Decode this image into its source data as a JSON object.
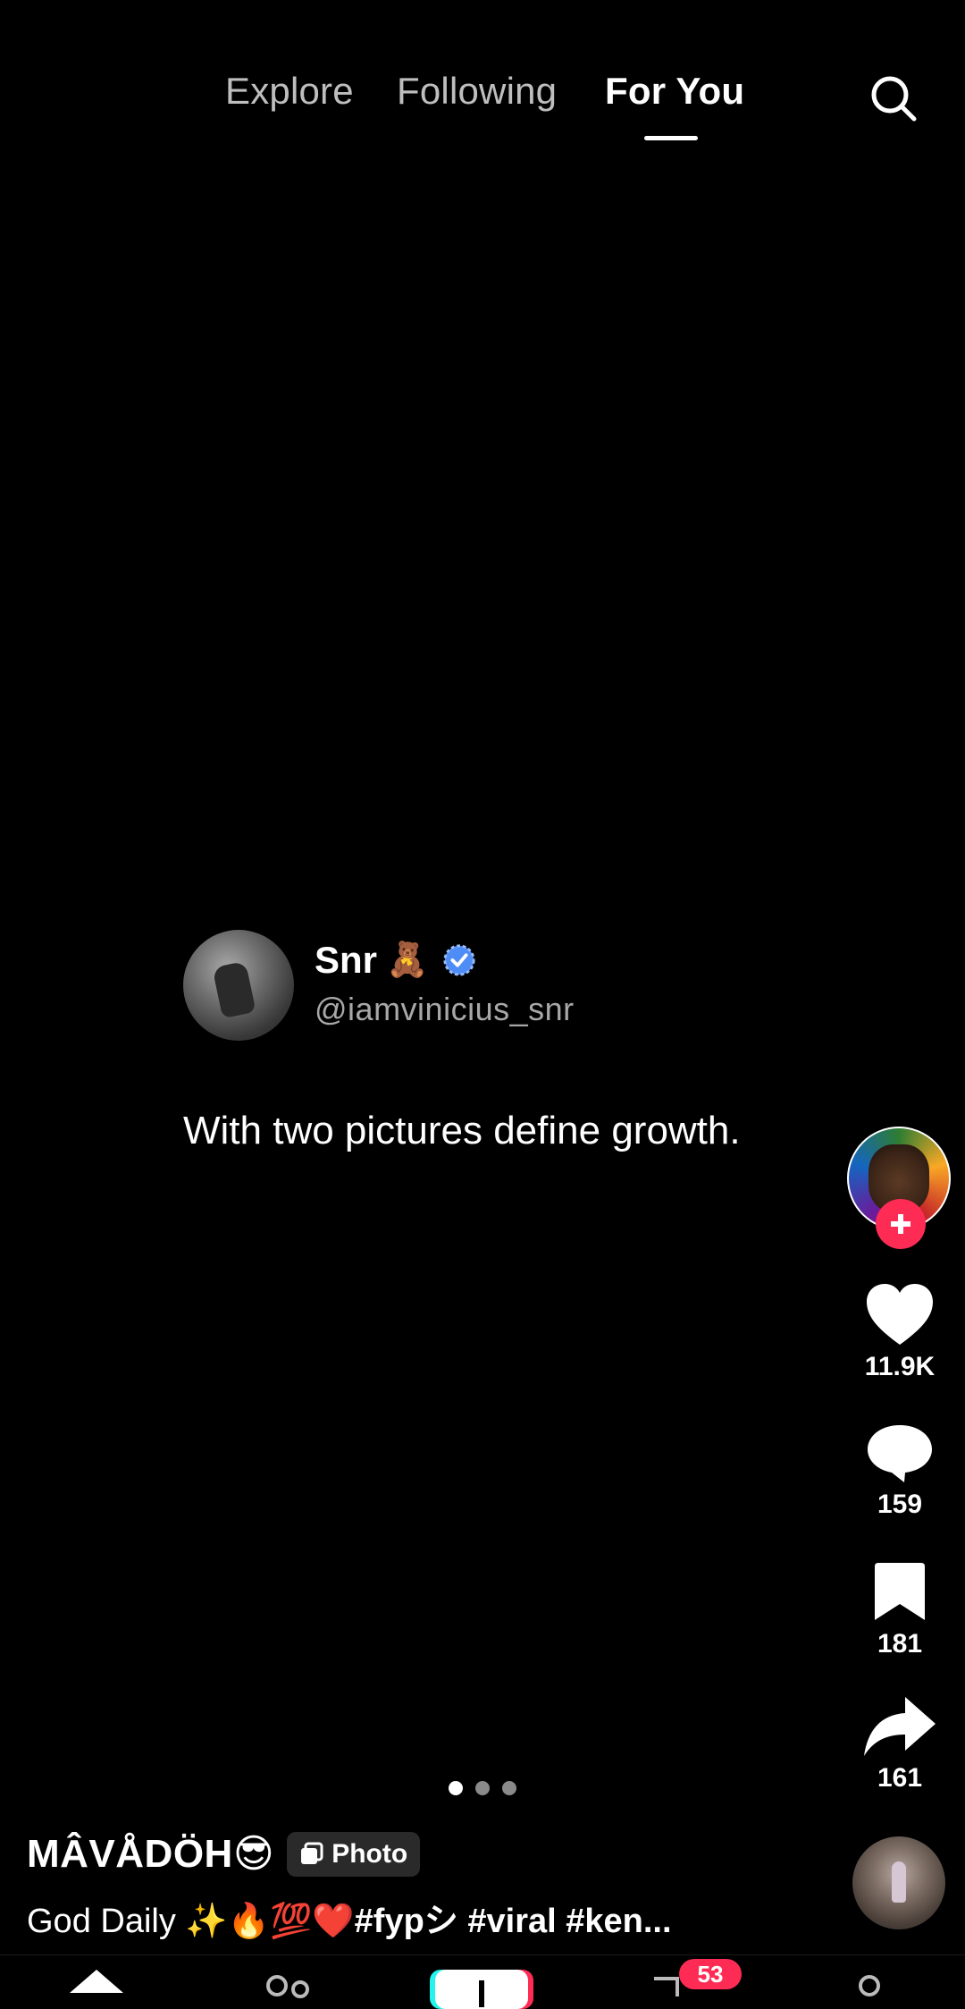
{
  "top_tabs": {
    "items": [
      {
        "label": "Explore",
        "active": false
      },
      {
        "label": "Following",
        "active": false
      },
      {
        "label": "For You",
        "active": true
      }
    ],
    "search_icon": "search-icon"
  },
  "post_card": {
    "name": "Snr",
    "name_emoji": "🧸",
    "verified": true,
    "handle": "@iamvinicius_snr",
    "text": "With two pictures define growth."
  },
  "actions": {
    "likes": "11.9K",
    "comments": "159",
    "saves": "181",
    "shares": "161"
  },
  "pagination": {
    "total": 3,
    "active_index": 0
  },
  "author": {
    "name": "MÂVÅDÖH😎",
    "badge": "Photo"
  },
  "caption": {
    "text": "God Daily ✨🔥💯❤️",
    "tags": "#fypシ #viral #ken..."
  },
  "bottom_nav": {
    "inbox_badge": "53"
  },
  "colors": {
    "accent": "#fe2c55",
    "cyan": "#25f4ee",
    "muted_text": "#c9c9c9"
  }
}
